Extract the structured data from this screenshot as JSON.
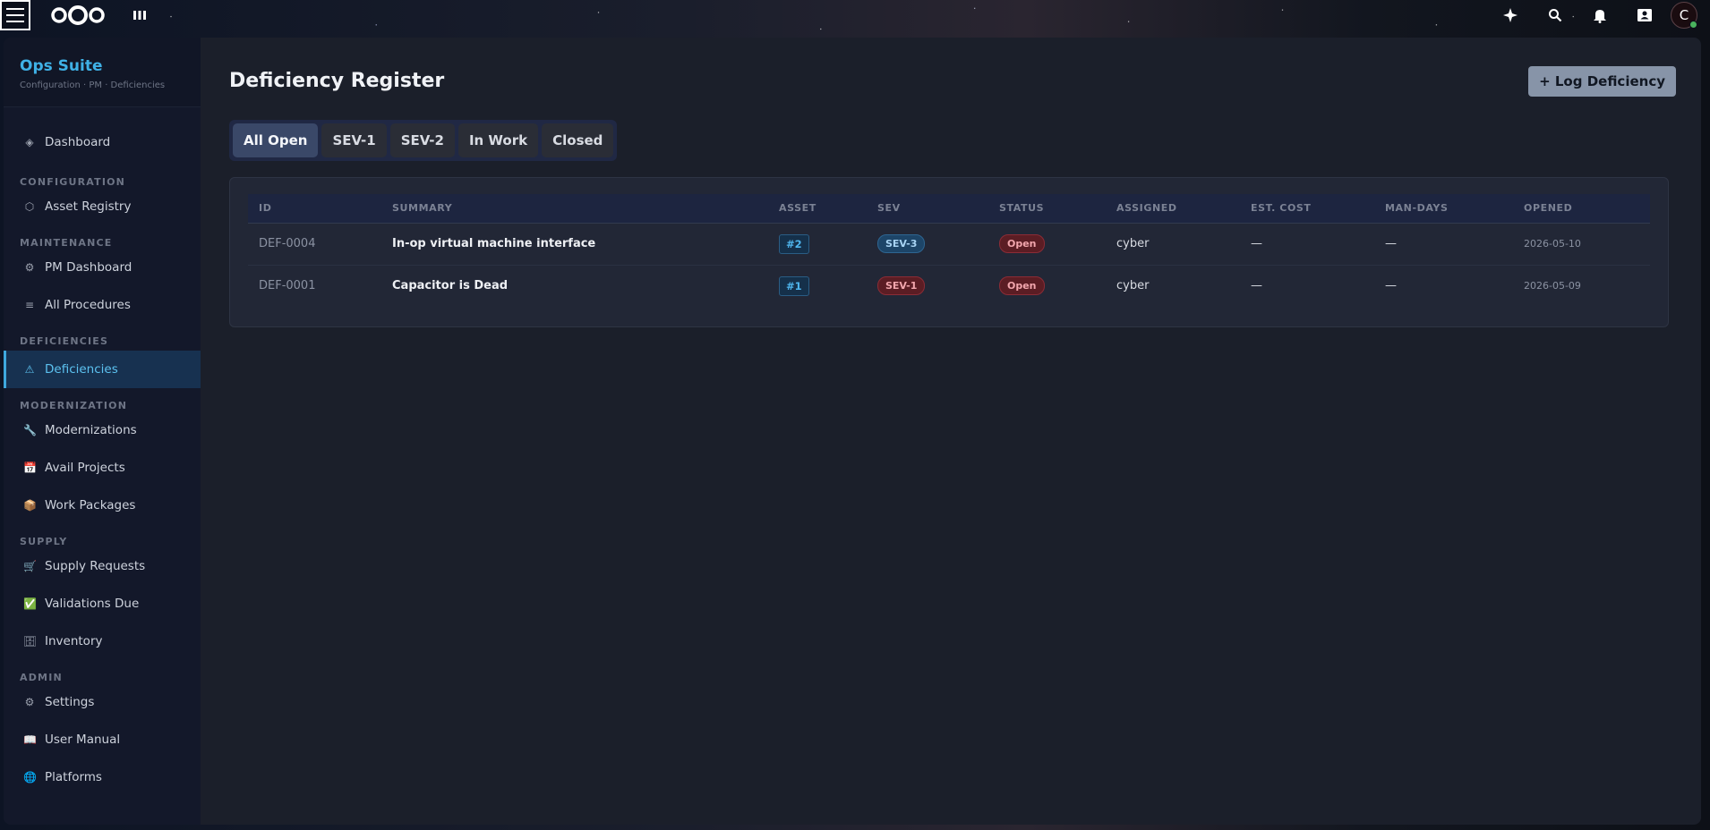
{
  "colors": {
    "brand": "#3fb1e6",
    "active_nav": "#173150",
    "accent_button": "#8794a8",
    "sev1": "#5b1d24",
    "sev3": "#1d4568",
    "status_open": "#5b1d24"
  },
  "topbar": {
    "icons": [
      "menu-icon",
      "nextcloud-logo-icon",
      "apps-icon",
      "assistant-sparkle-icon",
      "search-icon",
      "bell-icon",
      "contacts-icon"
    ],
    "avatar_letter": "C"
  },
  "sidebar": {
    "brand_title": "Ops Suite",
    "brand_subtitle": "Configuration · PM · Deficiencies",
    "dashboard": {
      "label": "Dashboard",
      "icon": "diamond-icon"
    },
    "sections": [
      {
        "title": "CONFIGURATION",
        "items": [
          {
            "label": "Asset Registry",
            "icon": "hexagon-icon"
          }
        ]
      },
      {
        "title": "MAINTENANCE",
        "items": [
          {
            "label": "PM Dashboard",
            "icon": "gear-icon"
          },
          {
            "label": "All Procedures",
            "icon": "list-icon"
          }
        ]
      },
      {
        "title": "DEFICIENCIES",
        "items": [
          {
            "label": "Deficiencies",
            "icon": "warning-icon",
            "active": true
          }
        ]
      },
      {
        "title": "MODERNIZATION",
        "items": [
          {
            "label": "Modernizations",
            "icon": "wrench-icon"
          },
          {
            "label": "Avail Projects",
            "icon": "calendar-icon"
          },
          {
            "label": "Work Packages",
            "icon": "package-icon"
          }
        ]
      },
      {
        "title": "SUPPLY",
        "items": [
          {
            "label": "Supply Requests",
            "icon": "cart-icon"
          },
          {
            "label": "Validations Due",
            "icon": "check-icon"
          },
          {
            "label": "Inventory",
            "icon": "cabinet-icon"
          }
        ]
      },
      {
        "title": "ADMIN",
        "items": [
          {
            "label": "Settings",
            "icon": "gear-icon"
          },
          {
            "label": "User Manual",
            "icon": "book-icon"
          },
          {
            "label": "Platforms",
            "icon": "globe-icon"
          }
        ]
      }
    ]
  },
  "main": {
    "title": "Deficiency Register",
    "log_button": "+ Log Deficiency",
    "tabs": [
      {
        "label": "All Open",
        "active": true
      },
      {
        "label": "SEV-1"
      },
      {
        "label": "SEV-2"
      },
      {
        "label": "In Work"
      },
      {
        "label": "Closed"
      }
    ],
    "table": {
      "columns": [
        "ID",
        "SUMMARY",
        "ASSET",
        "SEV",
        "STATUS",
        "ASSIGNED",
        "EST. COST",
        "MAN-DAYS",
        "OPENED"
      ],
      "rows": [
        {
          "id": "DEF-0004",
          "summary": "In-op virtual machine interface",
          "asset": "#2",
          "sev": "SEV-3",
          "status": "Open",
          "assigned": "cyber",
          "est_cost": "—",
          "man_days": "—",
          "opened": "2026-05-10"
        },
        {
          "id": "DEF-0001",
          "summary": "Capacitor is Dead",
          "asset": "#1",
          "sev": "SEV-1",
          "status": "Open",
          "assigned": "cyber",
          "est_cost": "—",
          "man_days": "—",
          "opened": "2026-05-09"
        }
      ]
    }
  }
}
